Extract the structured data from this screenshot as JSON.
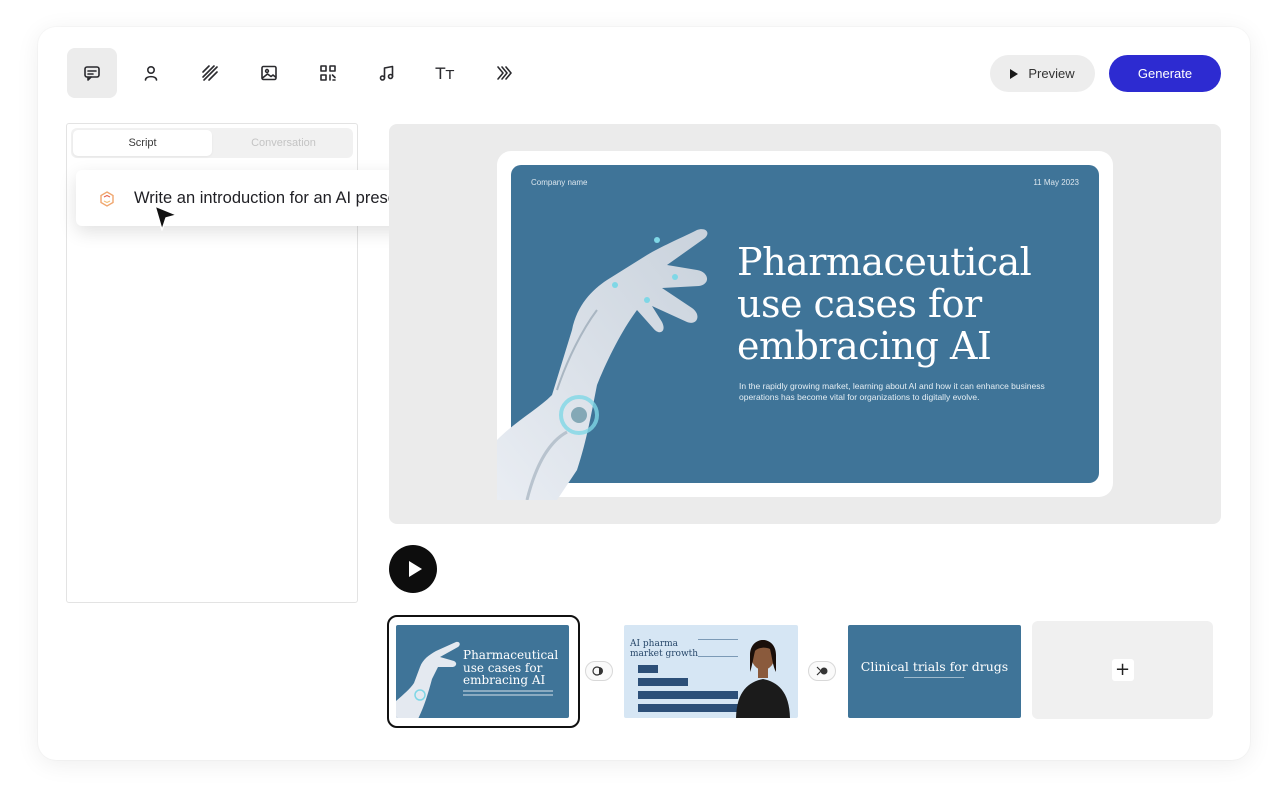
{
  "toolbar": {
    "tools": [
      "script-icon",
      "avatar-icon",
      "background-icon",
      "media-icon",
      "qr-code-icon",
      "music-icon",
      "text-icon",
      "transitions-icon"
    ],
    "text_tool_glyph": "Tт",
    "preview_label": "Preview",
    "generate_label": "Generate",
    "accent_color": "#2d2bd1"
  },
  "left_panel": {
    "tabs": [
      {
        "label": "Script",
        "active": true
      },
      {
        "label": "Conversation",
        "active": false
      }
    ],
    "prompt": "Write an introduction for an AI presentation"
  },
  "slide": {
    "company": "Company name",
    "date": "11 May 2023",
    "title": "Pharmaceutical use cases for embracing AI",
    "subtitle": "In the rapidly growing market, learning about AI and how it can enhance business operations has become vital for organizations to digitally evolve.",
    "background_color": "#3f7498"
  },
  "timeline": {
    "thumbnails": [
      {
        "title": "Pharmaceutical use cases for embracing AI",
        "selected": true
      },
      {
        "title": "AI pharma market growth",
        "selected": false
      },
      {
        "title": "Clinical trials for drugs",
        "selected": false
      }
    ],
    "add_label": "+"
  }
}
